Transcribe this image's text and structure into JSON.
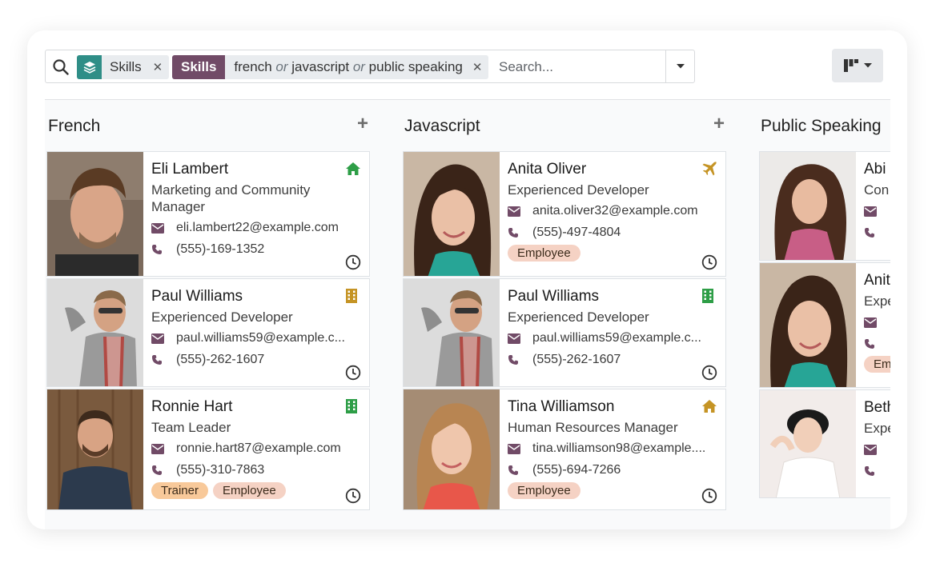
{
  "search": {
    "skill_facet_label": "Skills",
    "filter_facet_name": "Skills",
    "filter_values": [
      "french",
      "javascript",
      "public speaking"
    ],
    "or_word": "or",
    "placeholder": "Search..."
  },
  "columns": [
    {
      "title": "French",
      "cards": [
        {
          "name": "Eli Lambert",
          "job": "Marketing and Community Manager",
          "email": "eli.lambert22@example.com",
          "phone": "(555)-169-1352",
          "status": "home-icon",
          "tags": []
        },
        {
          "name": "Paul Williams",
          "job": "Experienced Developer",
          "email": "paul.williams59@example.c...",
          "phone": "(555)-262-1607",
          "status": "building-icon",
          "tags": []
        },
        {
          "name": "Ronnie Hart",
          "job": "Team Leader",
          "email": "ronnie.hart87@example.com",
          "phone": "(555)-310-7863",
          "status": "building-icon",
          "tags": [
            "Trainer",
            "Employee"
          ]
        }
      ]
    },
    {
      "title": "Javascript",
      "cards": [
        {
          "name": "Anita Oliver",
          "job": "Experienced Developer",
          "email": "anita.oliver32@example.com",
          "phone": "(555)-497-4804",
          "status": "plane-icon",
          "tags": [
            "Employee"
          ]
        },
        {
          "name": "Paul Williams",
          "job": "Experienced Developer",
          "email": "paul.williams59@example.c...",
          "phone": "(555)-262-1607",
          "status": "building-icon",
          "tags": []
        },
        {
          "name": "Tina Williamson",
          "job": "Human Resources Manager",
          "email": "tina.williamson98@example....",
          "phone": "(555)-694-7266",
          "status": "home-icon",
          "tags": [
            "Employee"
          ]
        }
      ]
    },
    {
      "title": "Public Speaking",
      "cards": [
        {
          "name": "Abi",
          "job": "Con",
          "tags": []
        },
        {
          "name": "Anit",
          "job": "Expe",
          "tags": [
            "Em"
          ]
        },
        {
          "name": "Beth",
          "job": "Expe",
          "tags": []
        }
      ]
    }
  ],
  "colors": {
    "brand": "#714b67",
    "skill_icon": "#2f8e87",
    "home_status": "#2e9e47",
    "building_status": "#c59425",
    "plane_status": "#c59425",
    "tag_trainer": "#f8c99a",
    "tag_employee": "#f5d2c4"
  }
}
